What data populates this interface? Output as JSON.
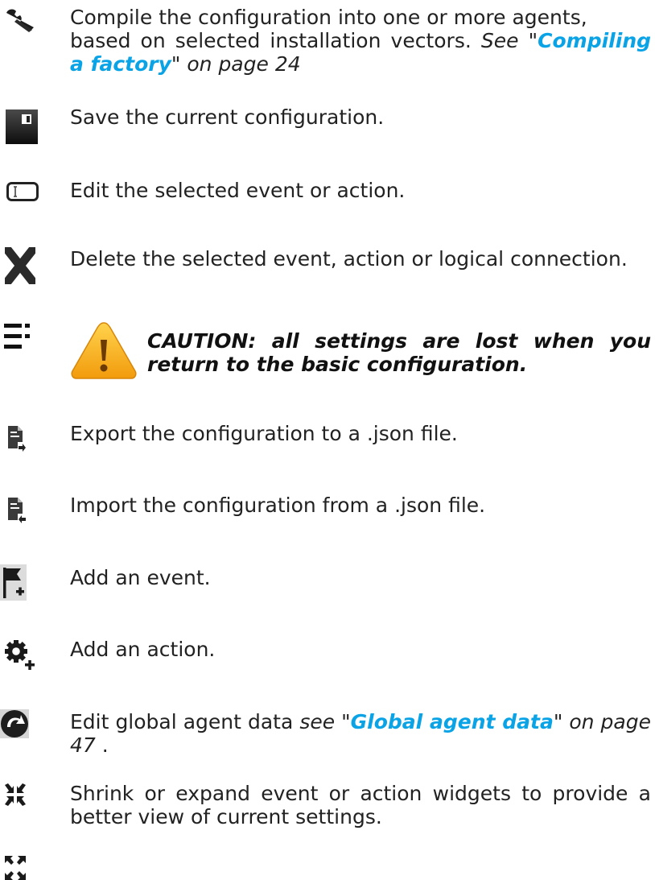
{
  "items": [
    {
      "icon": "wrench-icon",
      "text_line1": "Compile the configuration into one or more agents,",
      "text_line2": "based on selected installation vectors.",
      "see_prefix": "See \"",
      "link": "Compiling a factory",
      "see_suffix": "\" on page 24"
    },
    {
      "icon": "floppy-disk-icon",
      "text": "Save the current configuration."
    },
    {
      "icon": "text-field-icon",
      "text": "Edit the selected event or action."
    },
    {
      "icon": "delete-x-icon",
      "text": "Delete the selected event, action or logical connection."
    },
    {
      "icon": "menu-list-icon",
      "caution_icon": "warning-triangle-icon",
      "caution_text": "CAUTION: all settings are lost when you return to the basic configuration."
    },
    {
      "icon": "export-document-icon",
      "text": "Export the configuration to a .json file."
    },
    {
      "icon": "import-document-icon",
      "text": "Import the configuration from a .json file."
    },
    {
      "icon": "add-flag-icon",
      "text": "Add an event."
    },
    {
      "icon": "add-gear-icon",
      "text": "Add an action."
    },
    {
      "icon": "global-data-icon",
      "text_prefix": "Edit global agent data",
      "see_prefix": "see \"",
      "link": "Global agent data",
      "see_suffix": "\" on page 47",
      "trailing": " ."
    },
    {
      "icon": "shrink-icon",
      "icon2": "expand-icon",
      "text": "Shrink or expand event or action widgets to provide a better view of current settings."
    }
  ]
}
